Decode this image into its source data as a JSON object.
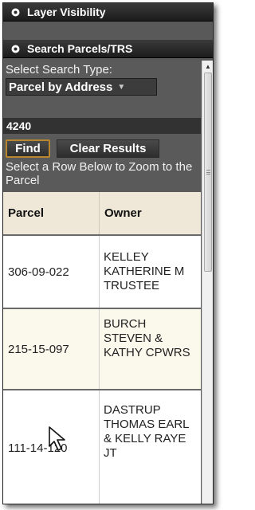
{
  "panels": {
    "layer_visibility": "Layer Visibility",
    "search_parcels": "Search Parcels/TRS"
  },
  "search": {
    "type_label": "Select Search Type:",
    "type_value": "Parcel by Address",
    "query_value": "4240"
  },
  "buttons": {
    "find": "Find",
    "clear": "Clear Results"
  },
  "instruction": "Select a Row Below to Zoom to the Parcel",
  "table": {
    "headers": [
      "Parcel",
      "Owner"
    ],
    "rows": [
      {
        "parcel": "306-09-022",
        "owner": "KELLEY KATHERINE M TRUSTEE"
      },
      {
        "parcel": "215-15-097",
        "owner": "BURCH STEVEN & KATHY CPWRS"
      },
      {
        "parcel": "111-14-120",
        "owner": "DASTRUP THOMAS EARL & KELLY RAYE JT"
      }
    ]
  },
  "icons": {
    "panel_header": "gear-icon",
    "dropdown": "chevron-down-icon",
    "cursor": "mouse-pointer-icon"
  },
  "colors": {
    "panel_bg": "#595959",
    "header_bg": "#1c1c1c",
    "find_border": "#b8862e",
    "table_header_bg": "#efe8d8"
  }
}
